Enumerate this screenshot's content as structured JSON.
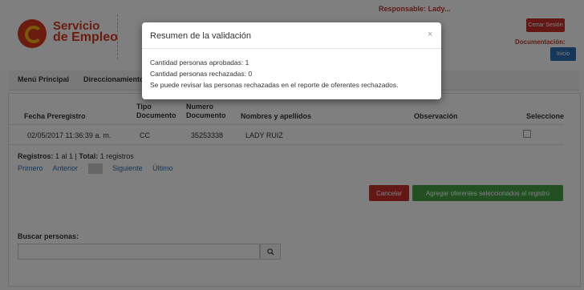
{
  "header": {
    "logo_line1": "Servicio",
    "logo_line2": "de Empleo",
    "responsable_label": "Responsable: Lady...",
    "documentacion_label": "Documentación:",
    "cerrar_sesion_label": "Cerrar Sesión",
    "inicio_label": "Inicio"
  },
  "nav": {
    "items": [
      "Menú Principal",
      "Direccionamiento"
    ]
  },
  "table": {
    "headers": {
      "fecha": "Fecha Preregistro",
      "tipo_l1": "Tipo",
      "tipo_l2": "Documento",
      "numero_l1": "Numero",
      "numero_l2": "Documento",
      "nombres": "Nombres y apellidos",
      "observacion": "Observación",
      "seleccione": "Seleccione"
    },
    "rows": [
      {
        "fecha": "02/05/2017 11:36:39 a. m.",
        "tipo": "CC",
        "numero": "35253338",
        "nombre": "LADY RUIZ",
        "observacion": ""
      }
    ]
  },
  "pagination": {
    "registros_label": "Registros:",
    "registros_range": " 1 al 1 | ",
    "total_label": "Total:",
    "total_value": " 1 registros",
    "primero": "Primero",
    "anterior": "Anterior",
    "siguiente": "Siguiente",
    "ultimo": "Último"
  },
  "actions": {
    "cancelar": "Cancelar",
    "agregar": "Agregar oferentes seleccionados al registro"
  },
  "search": {
    "label": "Buscar personas:",
    "value": ""
  },
  "modal": {
    "title": "Resumen de la validación",
    "close": "×",
    "line1": "Cantidad personas aprobadas: 1",
    "line2": "Cantidad personas rechazadas: 0",
    "line3": "Se puede revisar las personas rechazadas en el reporte de oferentes rechazados."
  },
  "colors": {
    "brand_red": "#d9381e",
    "danger": "#c9302c",
    "primary": "#2a6fb5",
    "success": "#44a047"
  }
}
